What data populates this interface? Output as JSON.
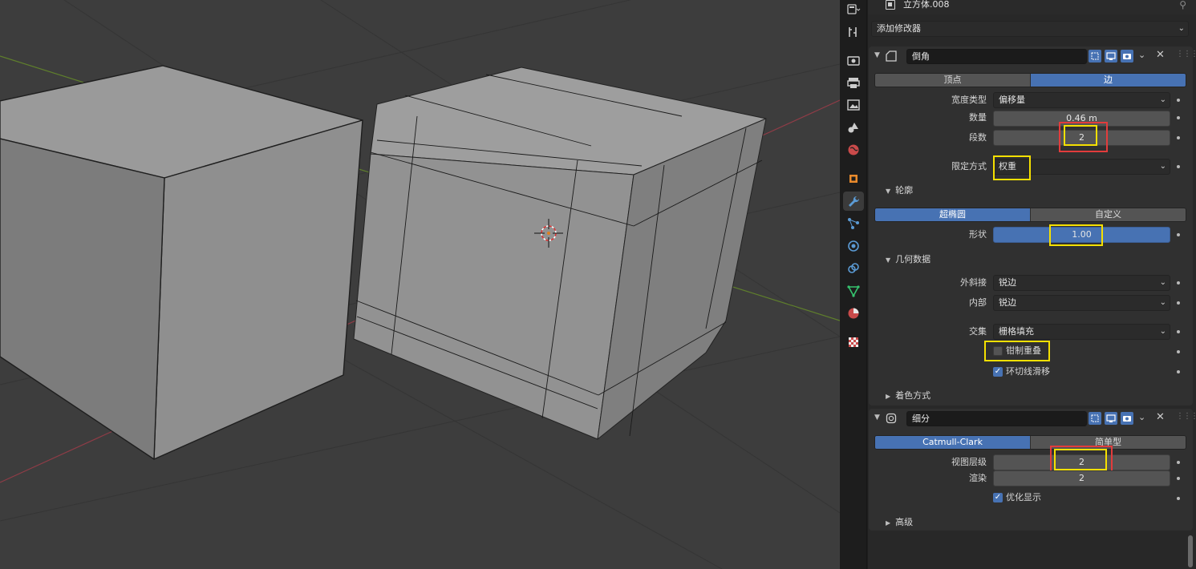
{
  "object": {
    "name": "立方体.008"
  },
  "add_modifier": {
    "label": "添加修改器"
  },
  "bevel": {
    "name": "倒角",
    "affect_options": [
      "顶点",
      "边"
    ],
    "width_type_label": "宽度类型",
    "width_type_value": "偏移量",
    "amount_label": "数量",
    "amount_value": "0.46 m",
    "segments_label": "段数",
    "segments_value": "2",
    "limit_method_label": "限定方式",
    "limit_method_value": "权重",
    "profile_section": "轮廓",
    "profile_options": [
      "超椭圆",
      "自定义"
    ],
    "shape_label": "形状",
    "shape_value": "1.00",
    "geometry_section": "几何数据",
    "miter_outer_label": "外斜接",
    "miter_outer_value": "锐边",
    "inner_label": "内部",
    "inner_value": "锐边",
    "intersection_label": "交集",
    "intersection_value": "栅格填充",
    "clamp_overlap_label": "钳制重叠",
    "clamp_overlap_checked": false,
    "loop_slide_label": "环切线滑移",
    "loop_slide_checked": true,
    "shading_section": "着色方式"
  },
  "subdivision": {
    "name": "细分",
    "type_options": [
      "Catmull-Clark",
      "简单型"
    ],
    "viewport_levels_label": "视图层级",
    "viewport_levels_value": "2",
    "render_label": "渲染",
    "render_value": "2",
    "optimal_display_label": "优化显示",
    "optimal_display_checked": true,
    "advanced_section": "高级"
  },
  "colors": {
    "accent": "#4772b3",
    "highlight_yellow": "#f5e000",
    "highlight_red": "#e23c3c"
  }
}
